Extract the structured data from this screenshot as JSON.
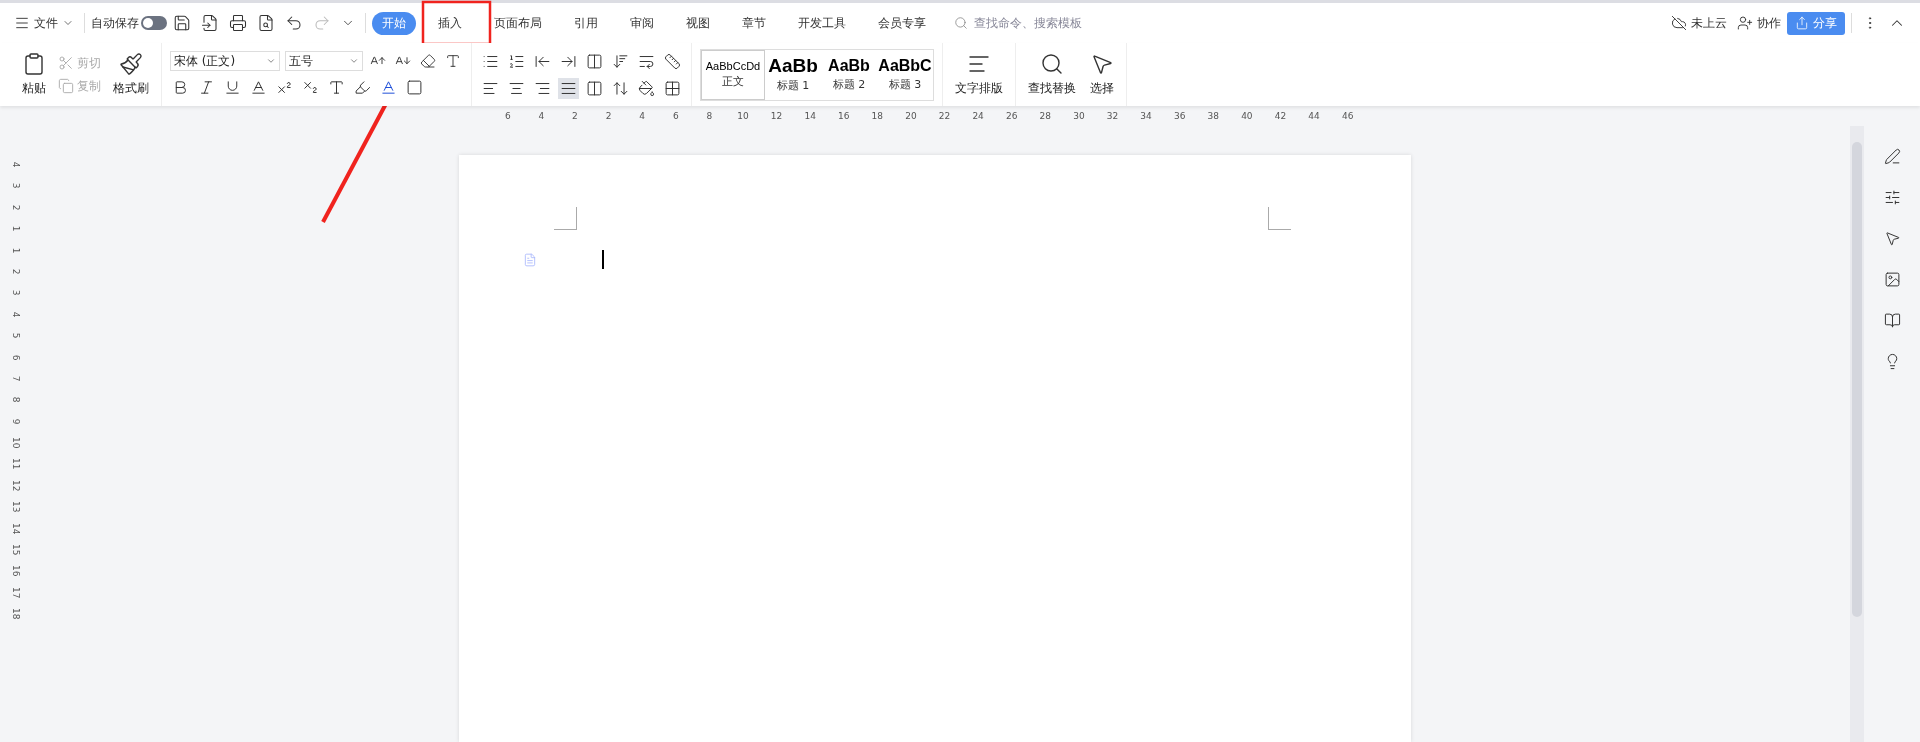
{
  "menu_bar": {
    "file_menu": "文件",
    "autosave": {
      "label": "自动保存",
      "on": false
    },
    "tabs": [
      {
        "label": "开始",
        "selected": true
      },
      {
        "label": "插入",
        "selected": false
      },
      {
        "label": "页面布局",
        "selected": false
      },
      {
        "label": "引用",
        "selected": false
      },
      {
        "label": "审阅",
        "selected": false
      },
      {
        "label": "视图",
        "selected": false
      },
      {
        "label": "章节",
        "selected": false
      },
      {
        "label": "开发工具",
        "selected": false
      },
      {
        "label": "会员专享",
        "selected": false
      }
    ],
    "search": {
      "placeholder": "查找命令、搜索模板"
    },
    "cloud_status": "未上云",
    "collaborate": "协作",
    "share": "分享"
  },
  "ribbon": {
    "paste": "粘贴",
    "cut": "剪切",
    "copy": "复制",
    "format_painter": "格式刷",
    "font_name": "宋体 (正文)",
    "font_size": "五号",
    "styles": [
      {
        "preview": "AaBbCcDd",
        "name": "正文",
        "selected": true
      },
      {
        "preview": "AaBb",
        "name": "标题 1",
        "selected": false
      },
      {
        "preview": "AaBb",
        "name": "标题 2",
        "selected": false
      },
      {
        "preview": "AaBbC",
        "name": "标题 3",
        "selected": false
      }
    ],
    "text_layout": "文字排版",
    "find_replace": "查找替换",
    "select": "选择"
  },
  "ruler": {
    "horizontal": [
      "6",
      "4",
      "2",
      "2",
      "4",
      "6",
      "8",
      "10",
      "12",
      "14",
      "16",
      "18",
      "20",
      "22",
      "24",
      "26",
      "28",
      "30",
      "32",
      "34",
      "36",
      "38",
      "40",
      "42",
      "44",
      "46"
    ],
    "vertical": [
      "4",
      "3",
      "2",
      "1",
      "1",
      "2",
      "3",
      "4",
      "5",
      "6",
      "7",
      "8",
      "9",
      "10",
      "11",
      "12",
      "13",
      "14",
      "15",
      "16",
      "17",
      "18"
    ]
  }
}
